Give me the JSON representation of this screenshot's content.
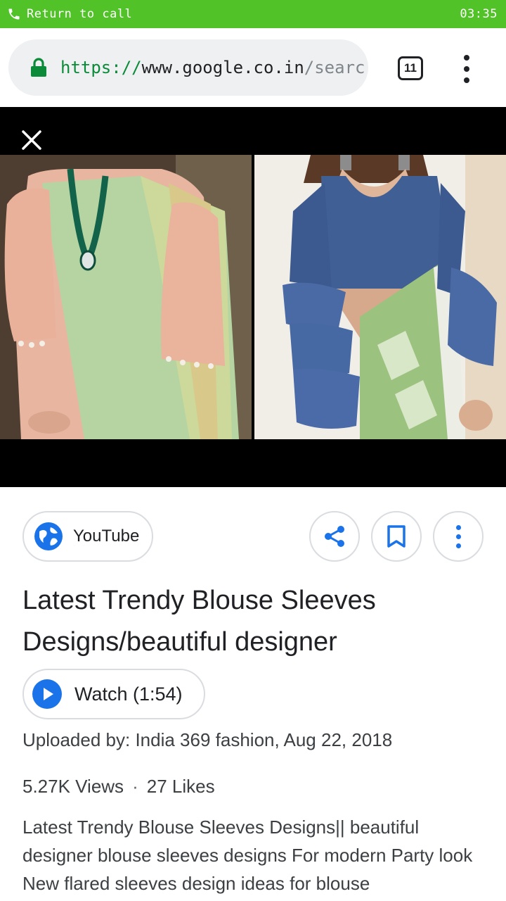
{
  "status_bar": {
    "call_text": "Return to call",
    "time": "03:35",
    "color": "#52c229"
  },
  "browser": {
    "url_scheme": "https://",
    "url_host": "www.google.co.in",
    "url_path": "/searc",
    "tab_count": "11",
    "lock_color": "#0b8a3a"
  },
  "viewer": {
    "close_icon": "close-icon",
    "images": [
      "pink-blouse-green-saree-photo",
      "blue-ruffle-sleeve-blouse-photo"
    ]
  },
  "source": {
    "label": "YouTube",
    "icon": "globe-icon"
  },
  "actions": {
    "share_icon": "share-icon",
    "save_icon": "bookmark-icon",
    "more_icon": "more-vert-icon",
    "accent": "#1a73e8"
  },
  "result": {
    "title": "Latest Trendy Blouse Sleeves Designs/beautiful designer",
    "watch_label": "Watch (1:54)",
    "uploaded": "Uploaded by: India 369 fashion, Aug 22, 2018",
    "views": "5.27K Views",
    "separator": "·",
    "likes": "27 Likes",
    "description": "Latest Trendy Blouse Sleeves Designs|| beautiful designer blouse sleeves designs For modern Party look New flared sleeves design ideas for blouse"
  }
}
